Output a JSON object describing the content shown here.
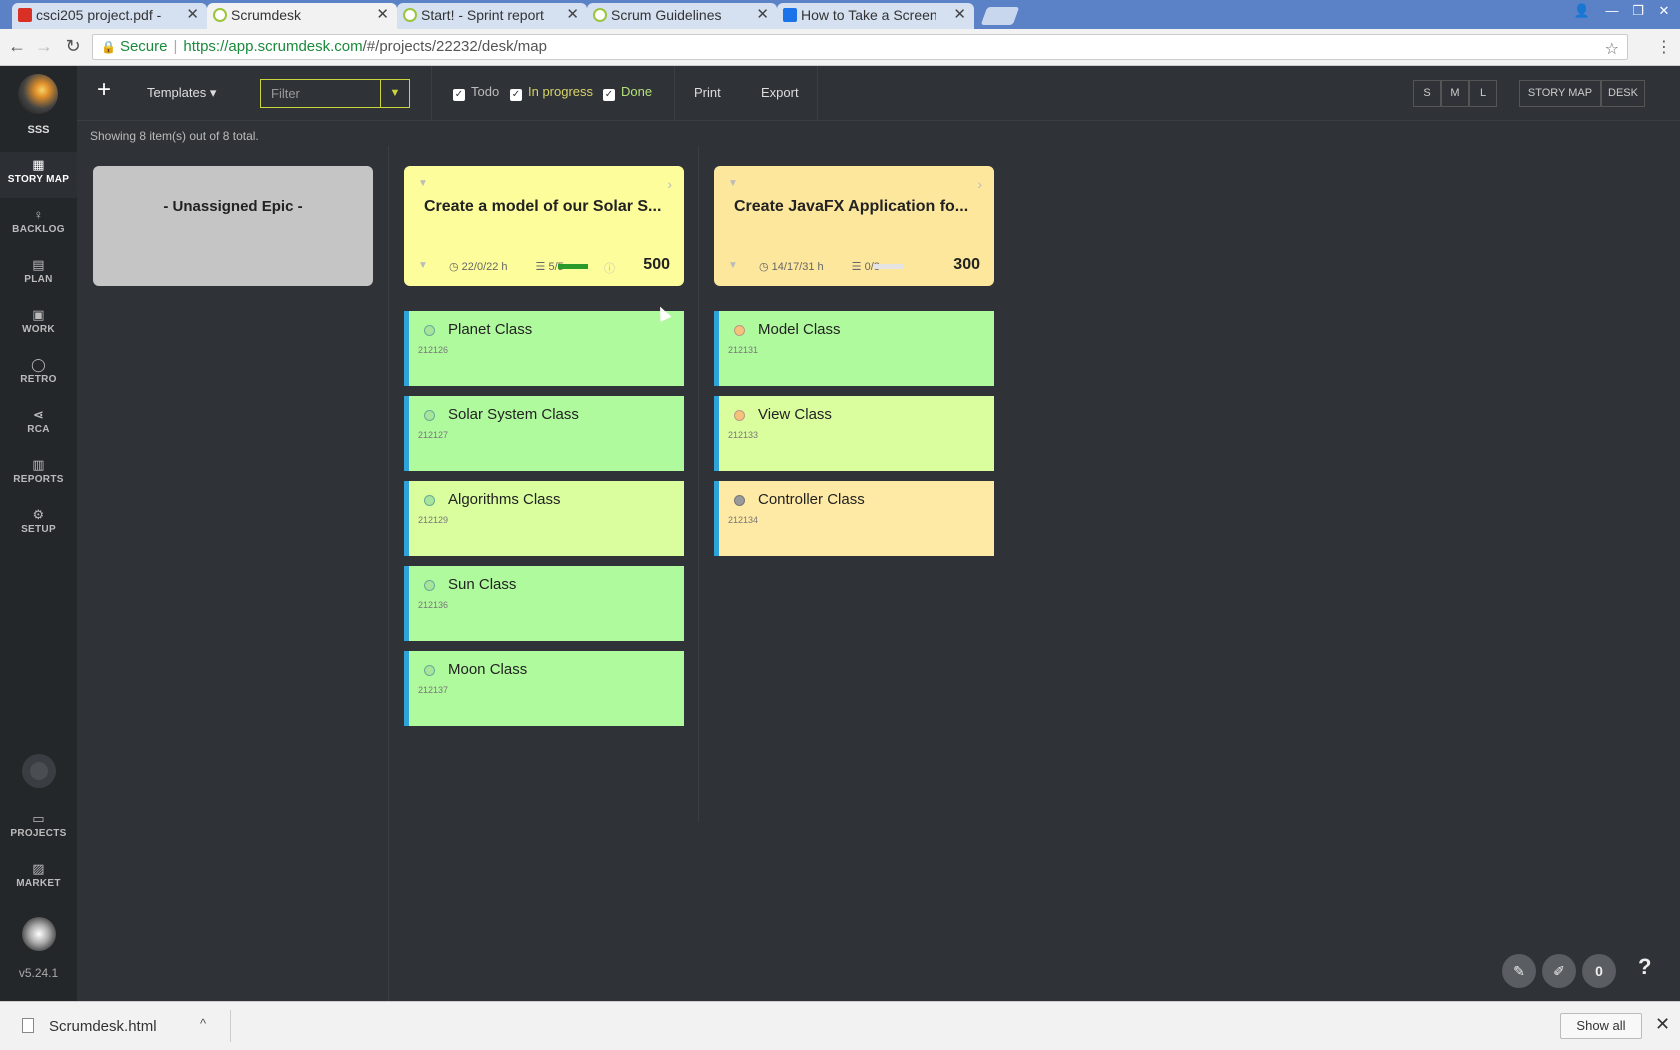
{
  "browser": {
    "tabs": [
      {
        "title": "csci205 project.pdf -",
        "favicon_color": "#d93025"
      },
      {
        "title": "Scrumdesk",
        "favicon_color": "#9bc53d"
      },
      {
        "title": "Start! - Sprint report",
        "favicon_color": "#9bc53d"
      },
      {
        "title": "Scrum Guidelines",
        "favicon_color": "#9bc53d"
      },
      {
        "title": "How to Take a Screen",
        "favicon_color": "#1a73e8"
      }
    ],
    "omnibox": {
      "secure_label": "Secure",
      "url_host": "https://app.scrumdesk.com",
      "url_path": "/#/projects/22232/desk/map"
    }
  },
  "sidebar": {
    "project_name": "SSS",
    "items": [
      {
        "label": "STORY MAP",
        "icon": "grid-icon"
      },
      {
        "label": "BACKLOG",
        "icon": "lightbulb-icon"
      },
      {
        "label": "PLAN",
        "icon": "list-icon"
      },
      {
        "label": "WORK",
        "icon": "briefcase-icon"
      },
      {
        "label": "RETRO",
        "icon": "chat-icon"
      },
      {
        "label": "RCA",
        "icon": "share-icon"
      },
      {
        "label": "REPORTS",
        "icon": "bar-chart-icon"
      },
      {
        "label": "SETUP",
        "icon": "gear-icon"
      }
    ],
    "bottom_items": [
      {
        "label": "PROJECTS",
        "icon": "folder-icon"
      },
      {
        "label": "MARKET",
        "icon": "shop-icon"
      }
    ],
    "version": "v5.24.1"
  },
  "toolbar": {
    "add": "+",
    "templates": "Templates ▾",
    "filter_placeholder": "Filter",
    "todo": "Todo",
    "in_progress": "In progress",
    "done": "Done",
    "print": "Print",
    "export": "Export",
    "sizes": [
      "S",
      "M",
      "L"
    ],
    "views": [
      "STORY MAP",
      "DESK"
    ]
  },
  "status": "Showing 8 item(s) out of 8 total.",
  "epics": [
    {
      "title": "- Unassigned Epic -"
    },
    {
      "title": "Create a model of our Solar S...",
      "time": "22/0/22 h",
      "tasks": "5/5",
      "progress": 1.0,
      "points": "500"
    },
    {
      "title": "Create JavaFX Application fo...",
      "time": "14/17/31 h",
      "tasks": "0/3",
      "progress": 0.0,
      "points": "300"
    }
  ],
  "stories": {
    "col1": [
      {
        "name": "Planet Class",
        "id": "212126"
      },
      {
        "name": "Solar System Class",
        "id": "212127"
      },
      {
        "name": "Algorithms Class",
        "id": "212129"
      },
      {
        "name": "Sun Class",
        "id": "212136"
      },
      {
        "name": "Moon Class",
        "id": "212137"
      }
    ],
    "col2": [
      {
        "name": "Model Class",
        "id": "212131"
      },
      {
        "name": "View Class",
        "id": "212133"
      },
      {
        "name": "Controller Class",
        "id": "212134"
      }
    ]
  },
  "footer": {
    "count": "0",
    "help": "?"
  },
  "downloads": {
    "file": "Scrumdesk.html",
    "show_all": "Show all"
  },
  "colors": {
    "accent": "#c9d53a",
    "story_border": "#2fa3d8",
    "progress_fill": "#2a9a2a"
  }
}
